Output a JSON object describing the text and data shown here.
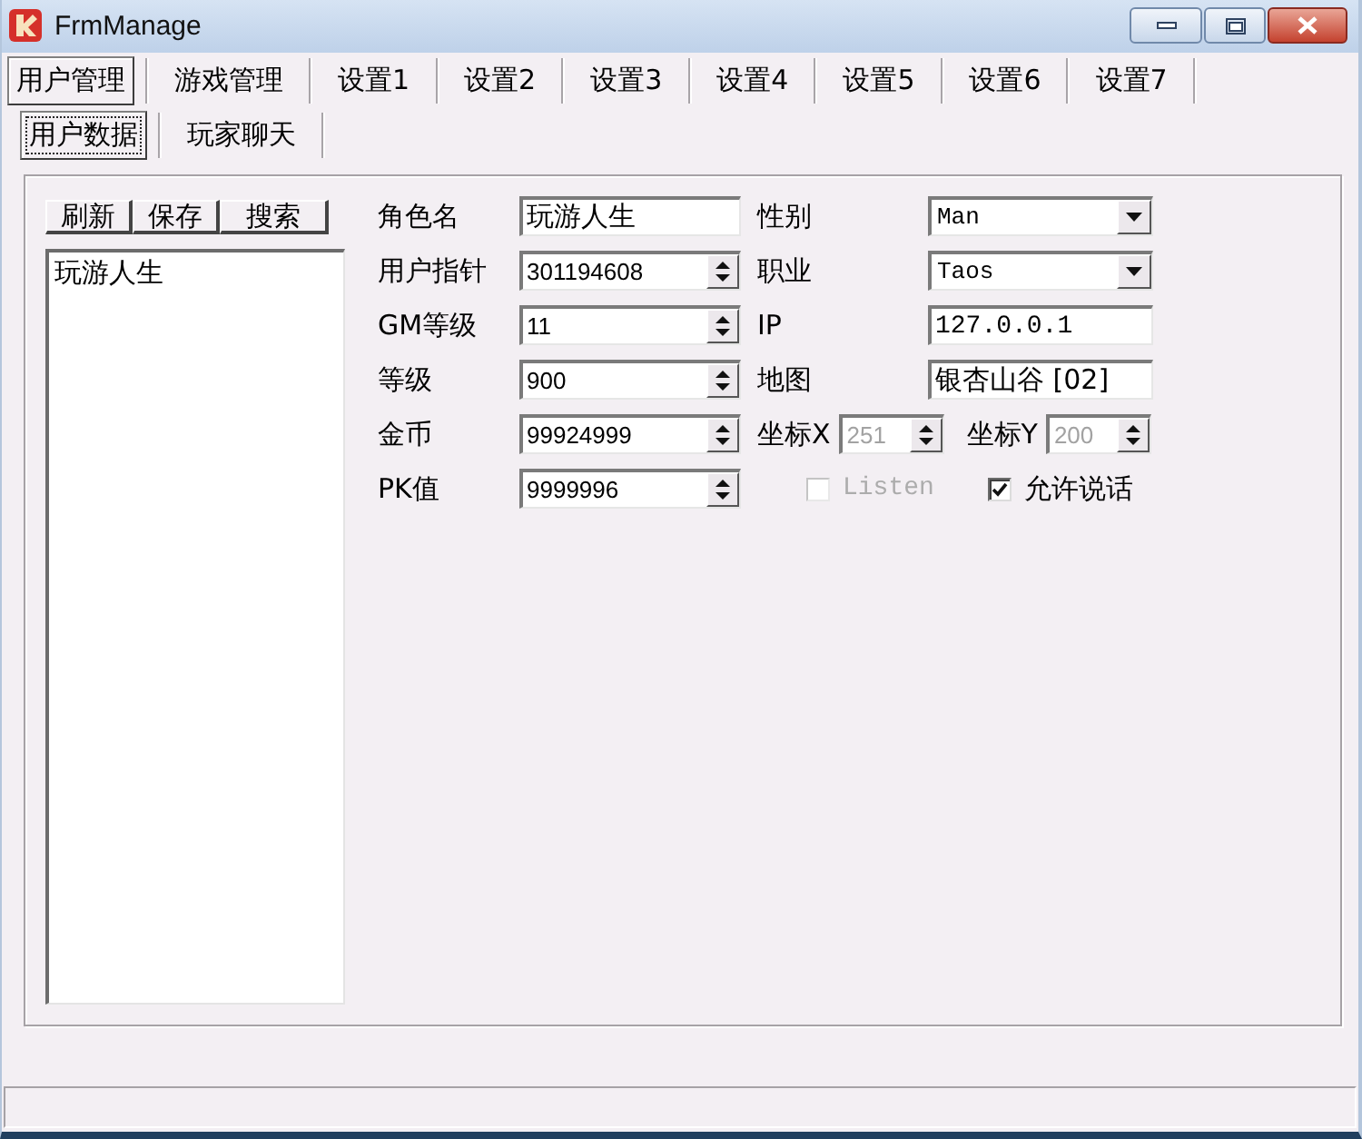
{
  "window": {
    "title": "FrmManage"
  },
  "tabs": [
    {
      "label": "用户管理",
      "selected": true
    },
    {
      "label": "游戏管理",
      "selected": false
    },
    {
      "label": "设置1",
      "selected": false
    },
    {
      "label": "设置2",
      "selected": false
    },
    {
      "label": "设置3",
      "selected": false
    },
    {
      "label": "设置4",
      "selected": false
    },
    {
      "label": "设置5",
      "selected": false
    },
    {
      "label": "设置6",
      "selected": false
    },
    {
      "label": "设置7",
      "selected": false
    }
  ],
  "subtabs": [
    {
      "label": "用户数据",
      "selected": true
    },
    {
      "label": "玩家聊天",
      "selected": false
    }
  ],
  "user_list": {
    "buttons": [
      "刷新",
      "保存",
      "搜索"
    ],
    "items": [
      "玩游人生"
    ]
  },
  "form": {
    "left": [
      {
        "kind": "text",
        "label": "角色名",
        "value": "玩游人生"
      },
      {
        "kind": "spin",
        "label": "用户指针",
        "value": "301194608"
      },
      {
        "kind": "spin",
        "label": "GM等级",
        "value": "11"
      },
      {
        "kind": "spin",
        "label": "等级",
        "value": "900"
      },
      {
        "kind": "spin",
        "label": "金币",
        "value": "99924999"
      },
      {
        "kind": "spin",
        "label": "PK值",
        "value": "9999996"
      }
    ],
    "right": [
      {
        "kind": "combo",
        "label": "性别",
        "value": "Man"
      },
      {
        "kind": "combo",
        "label": "职业",
        "value": "Taos"
      },
      {
        "kind": "text",
        "label": "IP",
        "value": "127.0.0.1"
      },
      {
        "kind": "text",
        "label": "地图",
        "value": "银杏山谷 [02]"
      },
      {
        "kind": "spins",
        "items": [
          {
            "label": "坐标X",
            "value": "251",
            "disabled": true
          },
          {
            "label": "坐标Y",
            "value": "200",
            "disabled": true
          }
        ]
      },
      {
        "kind": "checks",
        "items": [
          {
            "label": "Listen",
            "checked": false,
            "disabled": true
          },
          {
            "label": "允许说话",
            "checked": true,
            "disabled": false
          }
        ]
      }
    ]
  }
}
